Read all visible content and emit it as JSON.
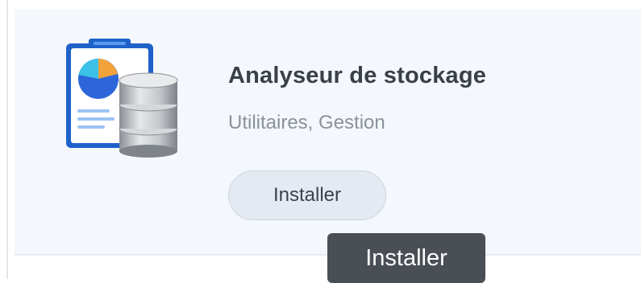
{
  "app": {
    "name": "Analyseur de stockage",
    "category": "Utilitaires, Gestion",
    "icon": "storage-analyzer-icon"
  },
  "actions": {
    "install_label": "Installer"
  },
  "tooltip": {
    "text": "Installer"
  },
  "colors": {
    "card_background": "#f4f7fb",
    "title": "#3a4048",
    "subtitle": "#8b929c",
    "button_background": "#e4eaf2",
    "button_border": "#cdd5df",
    "tooltip_background": "#4a4f56",
    "clipboard_blue": "#1f6fe0"
  }
}
